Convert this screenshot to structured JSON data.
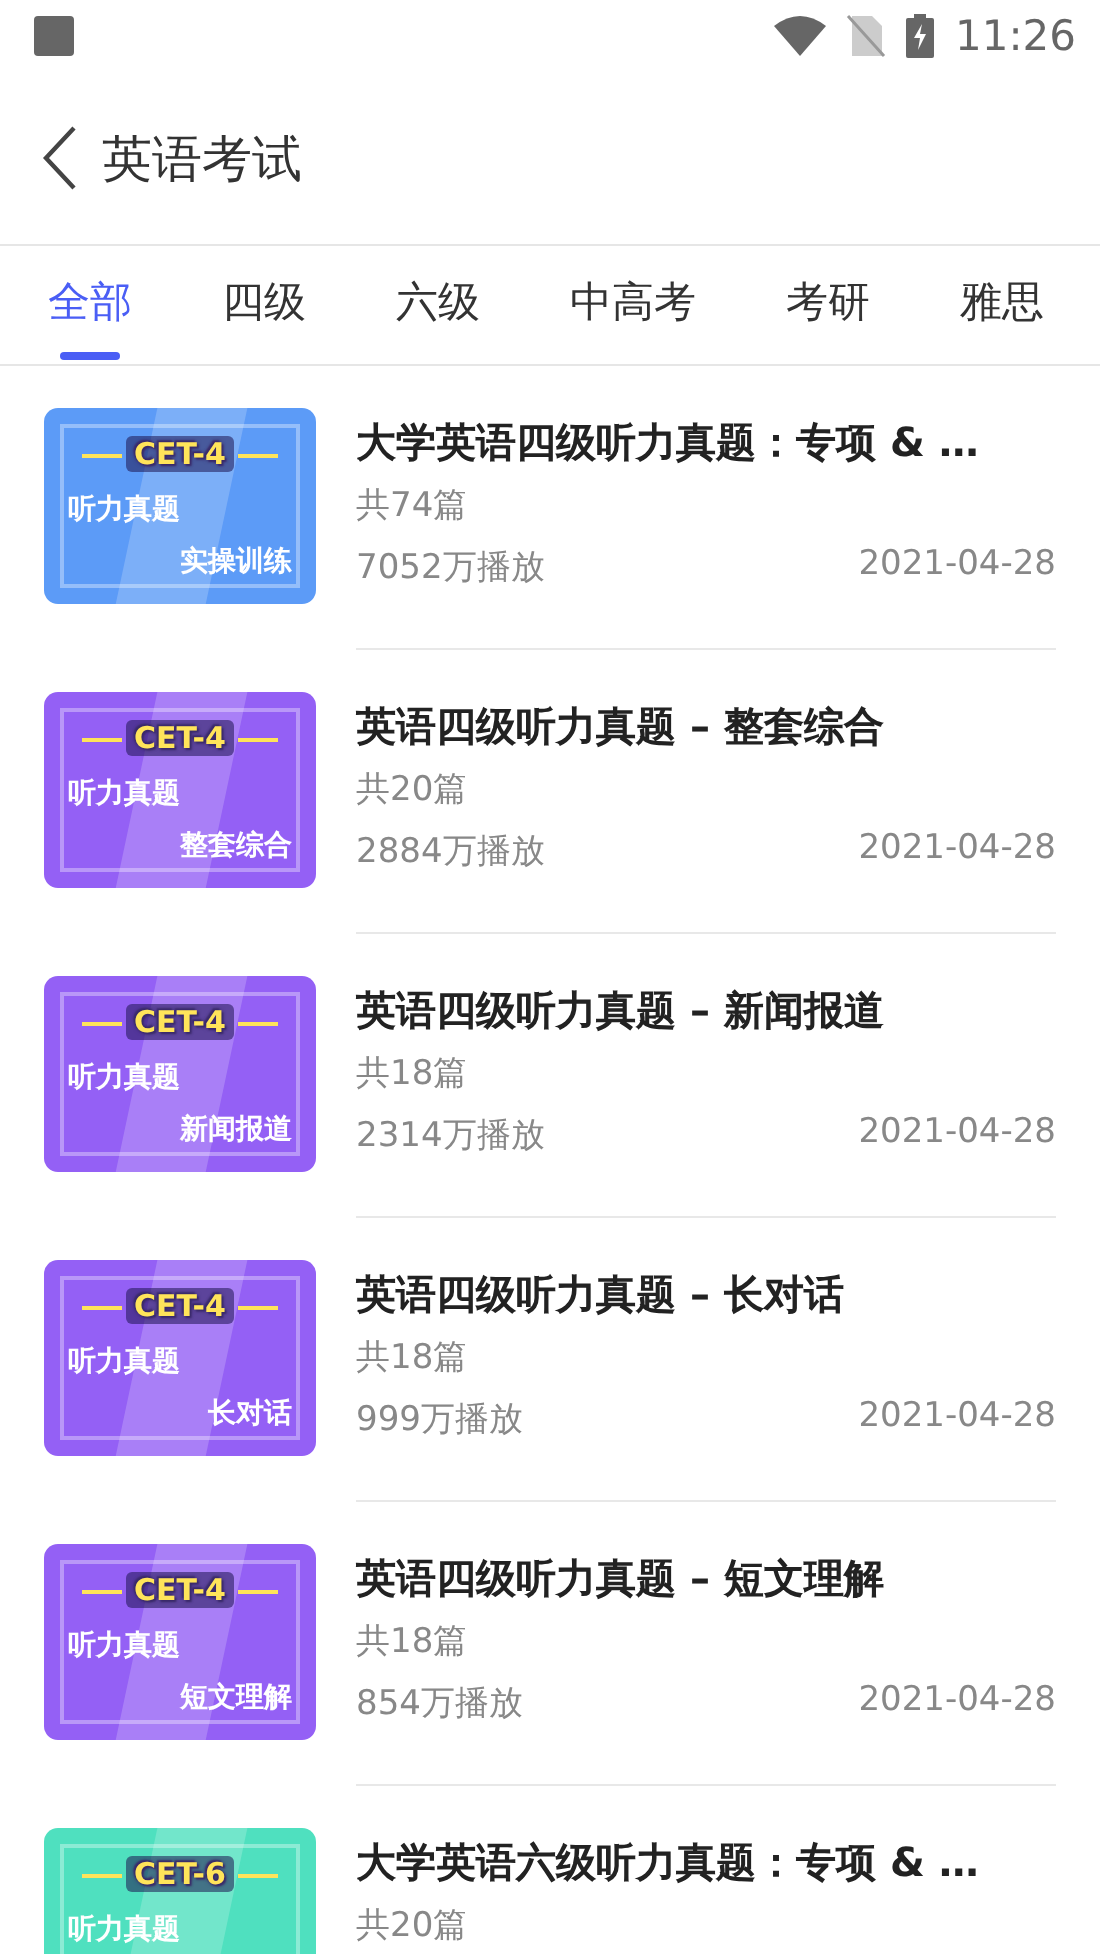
{
  "status_bar": {
    "time": "11:26"
  },
  "header": {
    "title": "英语考试"
  },
  "tabs": [
    {
      "label": "全部",
      "selected": true
    },
    {
      "label": "四级",
      "selected": false
    },
    {
      "label": "六级",
      "selected": false
    },
    {
      "label": "中高考",
      "selected": false
    },
    {
      "label": "考研",
      "selected": false
    },
    {
      "label": "雅思",
      "selected": false
    }
  ],
  "courses": [
    {
      "title": "大学英语四级听力真题：专项 & …",
      "count": "共74篇",
      "plays": "7052万播放",
      "date": "2021-04-28",
      "cover": {
        "color": "#5c9bf7",
        "badge": "CET-4",
        "line1": "听力真题",
        "line2": "实操训练"
      }
    },
    {
      "title": "英语四级听力真题 – 整套综合",
      "count": "共20篇",
      "plays": "2884万播放",
      "date": "2021-04-28",
      "cover": {
        "color": "#9460f5",
        "badge": "CET-4",
        "line1": "听力真题",
        "line2": "整套综合"
      }
    },
    {
      "title": "英语四级听力真题 – 新闻报道",
      "count": "共18篇",
      "plays": "2314万播放",
      "date": "2021-04-28",
      "cover": {
        "color": "#9460f5",
        "badge": "CET-4",
        "line1": "听力真题",
        "line2": "新闻报道"
      }
    },
    {
      "title": "英语四级听力真题 – 长对话",
      "count": "共18篇",
      "plays": "999万播放",
      "date": "2021-04-28",
      "cover": {
        "color": "#9460f5",
        "badge": "CET-4",
        "line1": "听力真题",
        "line2": "长对话"
      }
    },
    {
      "title": "英语四级听力真题 – 短文理解",
      "count": "共18篇",
      "plays": "854万播放",
      "date": "2021-04-28",
      "cover": {
        "color": "#9460f5",
        "badge": "CET-4",
        "line1": "听力真题",
        "line2": "短文理解"
      }
    },
    {
      "title": "大学英语六级听力真题：专项 & …",
      "count": "共20篇",
      "cover": {
        "color": "#4fe0bf",
        "badge": "CET-6",
        "line1": "听力真题"
      }
    }
  ]
}
